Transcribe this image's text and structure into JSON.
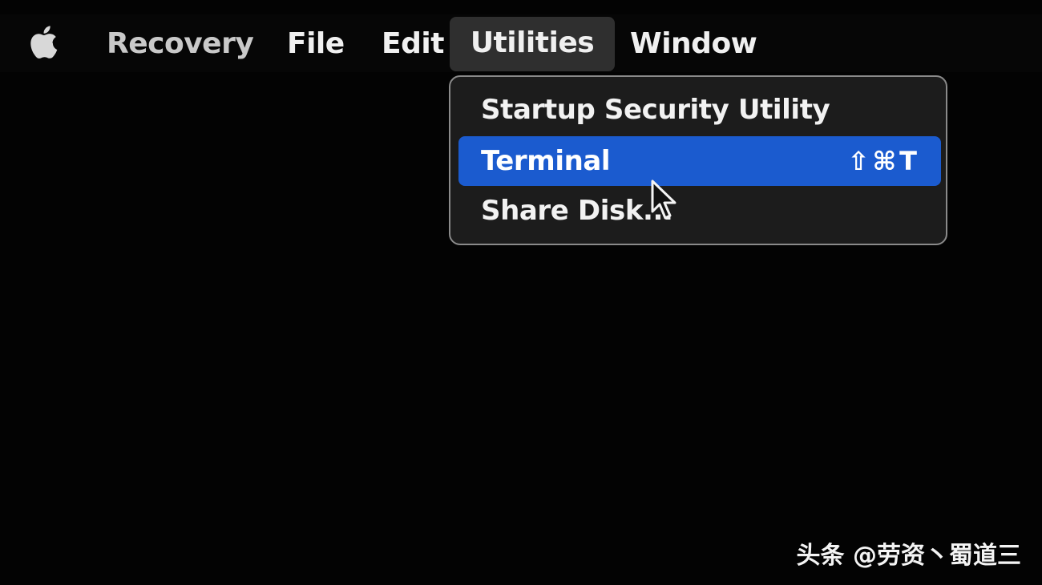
{
  "menubar": {
    "apple_icon": "apple-logo-icon",
    "items": [
      {
        "label": "Recovery"
      },
      {
        "label": "File"
      },
      {
        "label": "Edit"
      },
      {
        "label": "Utilities"
      },
      {
        "label": "Window"
      }
    ]
  },
  "utilities_menu": {
    "items": [
      {
        "label": "Startup Security Utility"
      },
      {
        "label": "Terminal",
        "shortcut": "⇧⌘T",
        "highlighted": true
      },
      {
        "label": "Share Disk..."
      }
    ]
  },
  "watermark": "头条 @劳资丶蜀道三",
  "colors": {
    "background": "#030303",
    "highlight": "#1b5bcf",
    "menu_bg": "#1c1c1c"
  }
}
